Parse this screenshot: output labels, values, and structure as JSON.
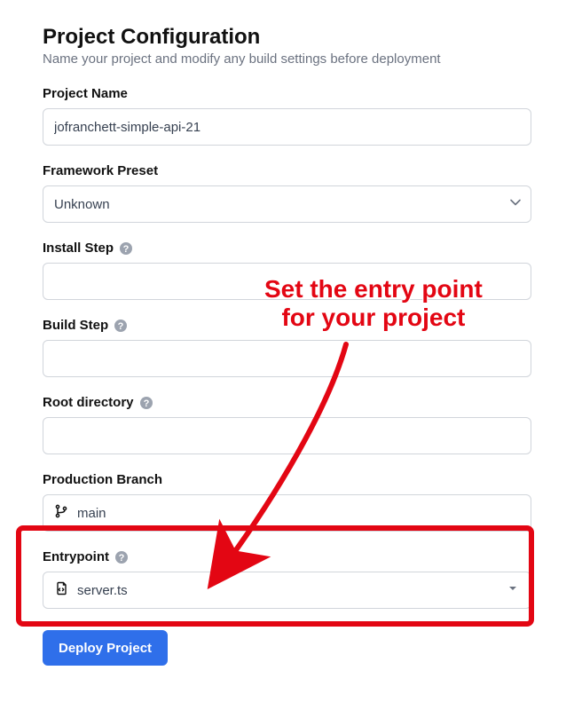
{
  "header": {
    "title": "Project Configuration",
    "subtitle": "Name your project and modify any build settings before deployment"
  },
  "fields": {
    "projectName": {
      "label": "Project Name",
      "value": "jofranchett-simple-api-21"
    },
    "frameworkPreset": {
      "label": "Framework Preset",
      "selected": "Unknown",
      "options": [
        "Unknown"
      ]
    },
    "installStep": {
      "label": "Install Step",
      "value": ""
    },
    "buildStep": {
      "label": "Build Step",
      "value": ""
    },
    "rootDirectory": {
      "label": "Root directory",
      "value": ""
    },
    "productionBranch": {
      "label": "Production Branch",
      "value": "main"
    },
    "entrypoint": {
      "label": "Entrypoint",
      "value": "server.ts"
    }
  },
  "actions": {
    "deploy_label": "Deploy Project"
  },
  "annotation": {
    "line1": "Set the entry point",
    "line2": "for your project"
  },
  "colors": {
    "accent_red": "#e30613",
    "primary_blue": "#2f6fea",
    "border_gray": "#d1d5db",
    "text_muted": "#6b7280"
  }
}
